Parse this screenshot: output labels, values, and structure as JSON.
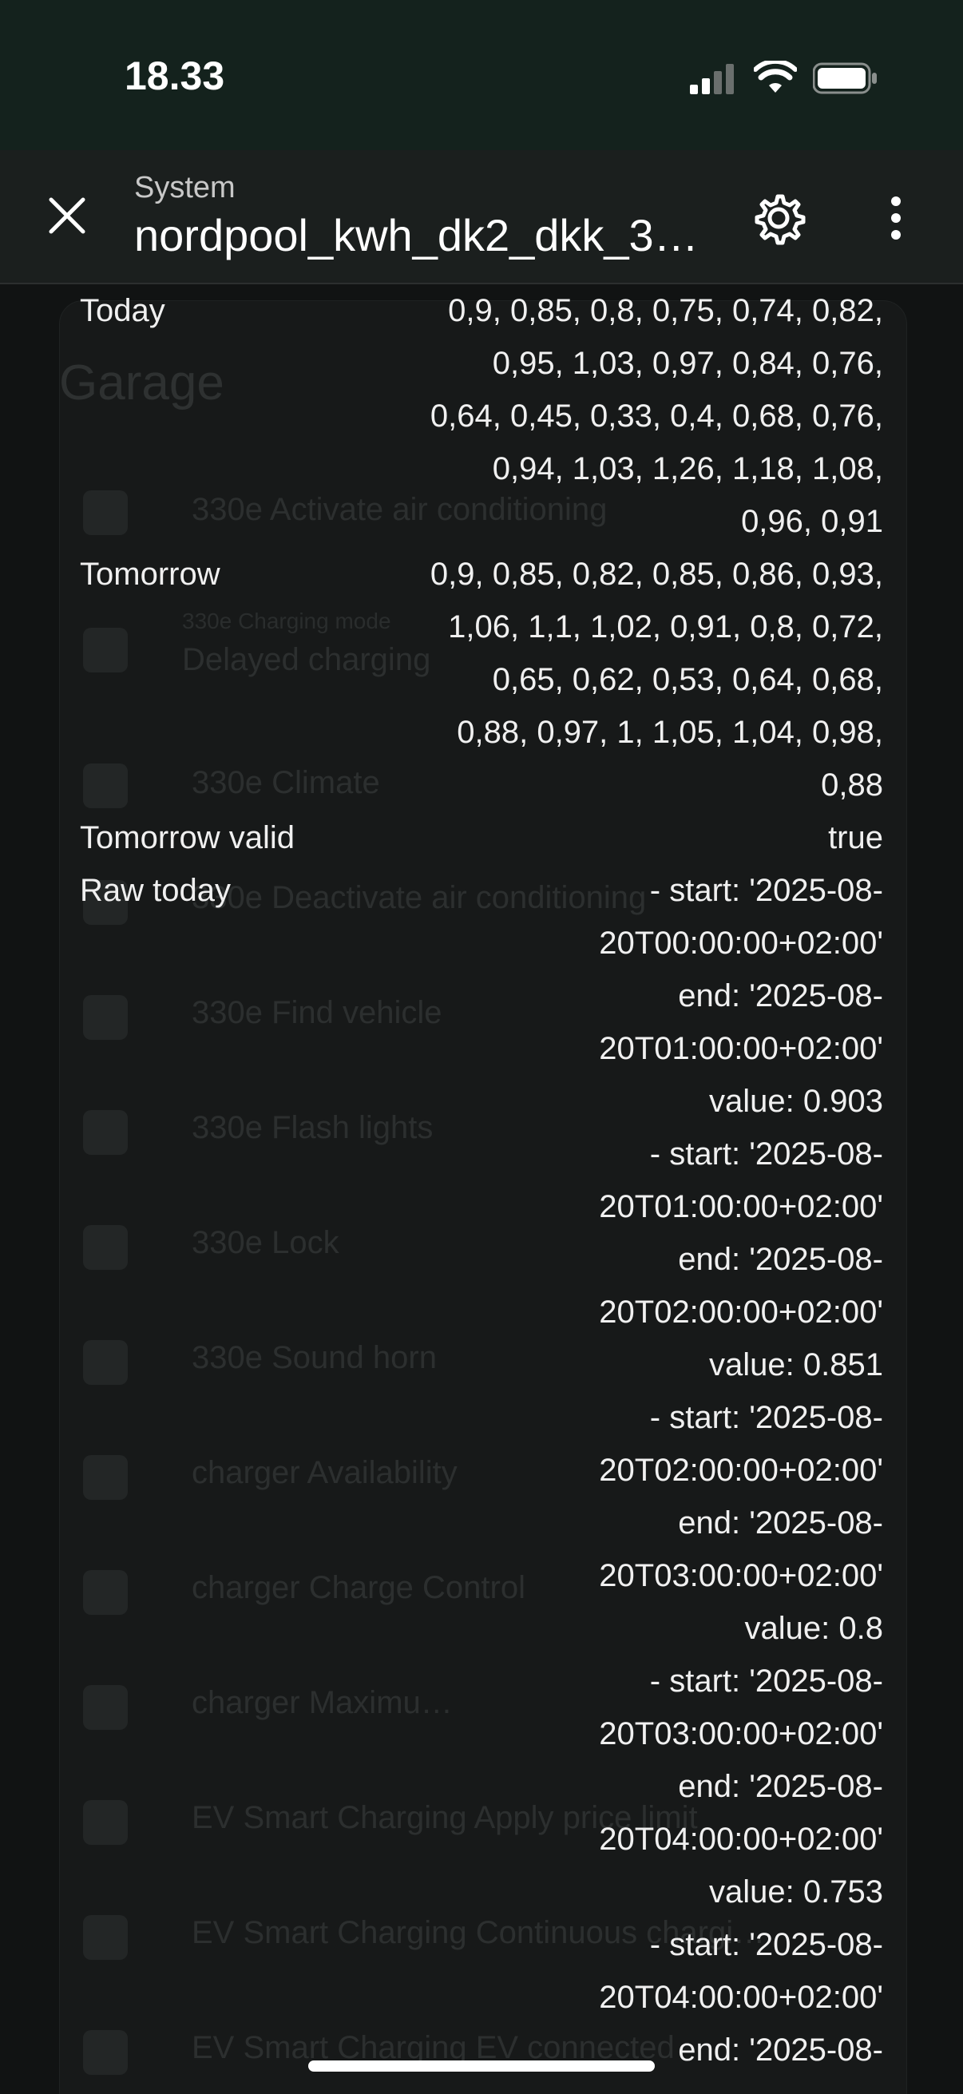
{
  "status": {
    "time": "18.33"
  },
  "header": {
    "subtitle": "System",
    "title": "nordpool_kwh_dk2_dkk_3…"
  },
  "attributes": [
    {
      "key": "Today",
      "lines": [
        "0,9, 0,85, 0,8, 0,75, 0,74, 0,82,",
        "0,95, 1,03, 0,97, 0,84, 0,76,",
        "0,64, 0,45, 0,33, 0,4, 0,68, 0,76,",
        "0,94, 1,03, 1,26, 1,18, 1,08,",
        "0,96, 0,91"
      ]
    },
    {
      "key": "Tomorrow",
      "lines": [
        "0,9, 0,85, 0,82, 0,85, 0,86, 0,93,",
        "1,06, 1,1, 1,02, 0,91, 0,8, 0,72,",
        "0,65, 0,62, 0,53, 0,64, 0,68,",
        "0,88, 0,97, 1, 1,05, 1,04, 0,98,",
        "0,88"
      ]
    },
    {
      "key": "Tomorrow valid",
      "lines": [
        "true"
      ]
    },
    {
      "key": "Raw today",
      "lines": [
        "- start: '2025-08-",
        "20T00:00:00+02:00'",
        "end: '2025-08-",
        "20T01:00:00+02:00'",
        "value: 0.903",
        "- start: '2025-08-",
        "20T01:00:00+02:00'",
        "end: '2025-08-",
        "20T02:00:00+02:00'",
        "value: 0.851",
        "- start: '2025-08-",
        "20T02:00:00+02:00'",
        "end: '2025-08-",
        "20T03:00:00+02:00'",
        "value: 0.8",
        "- start: '2025-08-",
        "20T03:00:00+02:00'",
        "end: '2025-08-",
        "20T04:00:00+02:00'",
        "value: 0.753",
        "- start: '2025-08-",
        "20T04:00:00+02:00'",
        "end: '2025-08-"
      ]
    }
  ],
  "background": {
    "title": "Garage",
    "items": [
      "330e Activate air conditioning",
      "Delayed charging",
      "330e Climate",
      "330e Deactivate air conditioning",
      "330e Find vehicle",
      "330e Flash lights",
      "330e Lock",
      "330e Sound horn",
      "charger Availability",
      "charger Charge Control",
      "charger Maximu…",
      "EV Smart Charging Apply price limit",
      "EV Smart Charging Continuous chargi…",
      "EV Smart Charging EV connected"
    ],
    "sub_label": "330e Charging mode"
  }
}
